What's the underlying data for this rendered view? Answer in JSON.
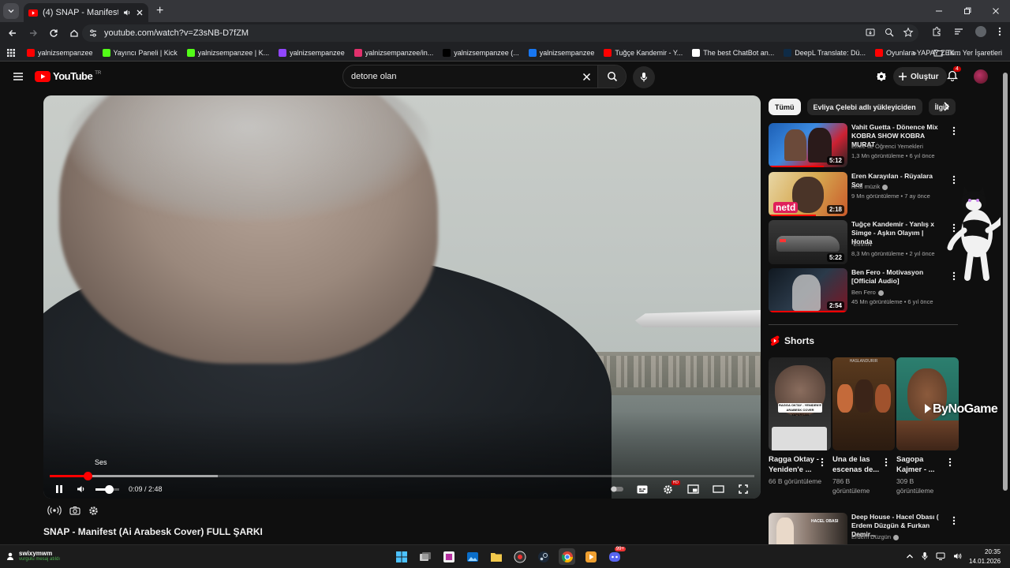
{
  "browser": {
    "tab_title": "(4) SNAP - Manifest (Ai Arabesk Cover) FULL ŞARKI - YouTube",
    "url": "youtube.com/watch?v=Z3sNB-D7fZM",
    "bookmarks": [
      {
        "label": "yalnizsempanzee",
        "icon_color": "#ff0000"
      },
      {
        "label": "Yayıncı Paneli | Kick",
        "icon_color": "#53fc18"
      },
      {
        "label": "yalnizsempanzee | K...",
        "icon_color": "#53fc18"
      },
      {
        "label": "yalnizsempanzee",
        "icon_color": "#9146ff"
      },
      {
        "label": "yalnizsempanzee/in...",
        "icon_color": "#e1306c"
      },
      {
        "label": "yalnizsempanzee (...",
        "icon_color": "#000000"
      },
      {
        "label": "yalnizsempanzee",
        "icon_color": "#1877f2"
      },
      {
        "label": "Tuğçe Kandemir - Y...",
        "icon_color": "#ff0000"
      },
      {
        "label": "The best ChatBot an...",
        "icon_color": "#ffffff"
      },
      {
        "label": "DeepL Translate: Dü...",
        "icon_color": "#0f2b46"
      },
      {
        "label": "Oyunlara YAPAY ZEK...",
        "icon_color": "#ff0000"
      }
    ],
    "all_bookmarks_label": "Tüm Yer İşaretleri"
  },
  "masthead": {
    "logo_text": "YouTube",
    "country_code": "TR",
    "search_value": "detone olan",
    "create_label": "Oluştur",
    "notification_count": "4",
    "brand_color": "#ff0000"
  },
  "player": {
    "tooltip": "Ses",
    "time_display": "0:09 / 2:48",
    "progress_fraction": 0.054,
    "buffered_fraction": 0.238,
    "volume_fraction": 0.55,
    "hd_badge": "HD"
  },
  "video": {
    "title": "SNAP - Manifest (Ai Arabesk Cover) FULL ŞARKI"
  },
  "chips": [
    "Tümü",
    "Evliya Çelebi adlı yükleyiciden",
    "İlgili"
  ],
  "recommendations": [
    {
      "title": "Vahit Guetta - Dönence Mix KOBRA SHOW KOBRA MURAT",
      "channel": "Emre İle Öğrenci Yemekleri",
      "verified": false,
      "meta": "1,3 Mn görüntüleme • 6 yıl önce",
      "duration": "5:12",
      "watched": 0.7
    },
    {
      "title": "Eren Karayılan - Rüyalara Sor",
      "channel": "netd müzik",
      "verified": true,
      "meta": "9 Mn görüntüleme • 7 ay önce",
      "duration": "2:18",
      "watched": 0.6
    },
    {
      "title": "Tuğçe Kandemir - Yanlış x Simge - Aşkın Olayım | Honda",
      "channel": "-EmrhN",
      "verified": false,
      "meta": "8,3 Mn görüntüleme • 2 yıl önce",
      "duration": "5:22",
      "watched": 0
    },
    {
      "title": "Ben Fero - Motivasyon [Official Audio]",
      "channel": "Ben Fero",
      "verified": true,
      "meta": "45 Mn görüntüleme • 6 yıl önce",
      "duration": "2:54",
      "watched": 1.0
    }
  ],
  "shorts": {
    "heading": "Shorts",
    "items": [
      {
        "title": "Ragga Oktay - Yeniden'e ...",
        "views": "66 B görüntüleme",
        "overlay": "RAGGA OKTAY - YENIDEN'E ARABESK COVER YAPARSAN"
      },
      {
        "title": "Una de las escenas de...",
        "views": "786 B görüntüleme",
        "overlay": "HASLANDURIR"
      },
      {
        "title": "Sagopa Kajmer - ...",
        "views": "309 B görüntüleme",
        "overlay": ""
      }
    ]
  },
  "last_recommendation": {
    "title": "Deep House - Hacel Obası ( Erdem Düzgün & Furkan Demir...",
    "channel": "Erdem Düzgün",
    "verified": true,
    "thumb_text": "HACEL OBASI"
  },
  "watermark": "ByNoGame",
  "taskbar": {
    "user_name": "swixymwm",
    "user_status": "vurgulu mesaj atıldı",
    "time": "20:35",
    "date": "14.01.2026",
    "badge": "99+"
  }
}
